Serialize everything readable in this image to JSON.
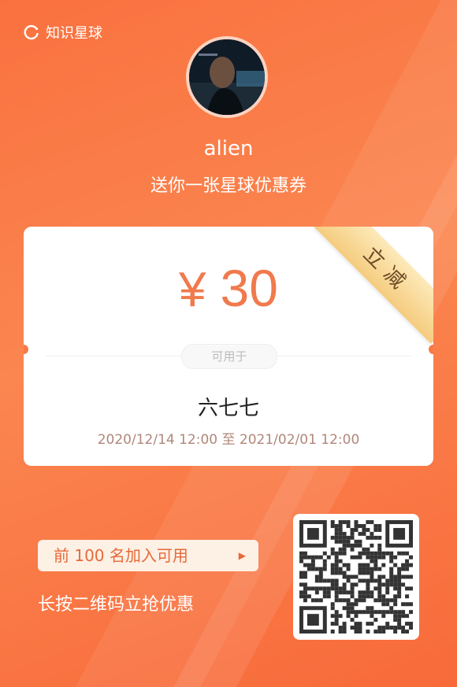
{
  "brand": {
    "name": "知识星球",
    "icon": "planet-icon"
  },
  "user": {
    "name": "alien",
    "avatar": "avatar-photo"
  },
  "subtitle": "送你一张星球优惠券",
  "coupon": {
    "currency": "¥",
    "amount": "30",
    "ribbon": "立减",
    "tag": "可用于",
    "group_name": "六七七",
    "validity": "2020/12/14 12:00 至 2021/02/01 12:00"
  },
  "promo": {
    "limit_text": "前 100 名加入可用",
    "arrow": "▶",
    "hint": "长按二维码立抢优惠"
  },
  "colors": {
    "accent": "#f9713f",
    "amount": "#f07a4d",
    "ribbon": "#f5cc7f"
  }
}
